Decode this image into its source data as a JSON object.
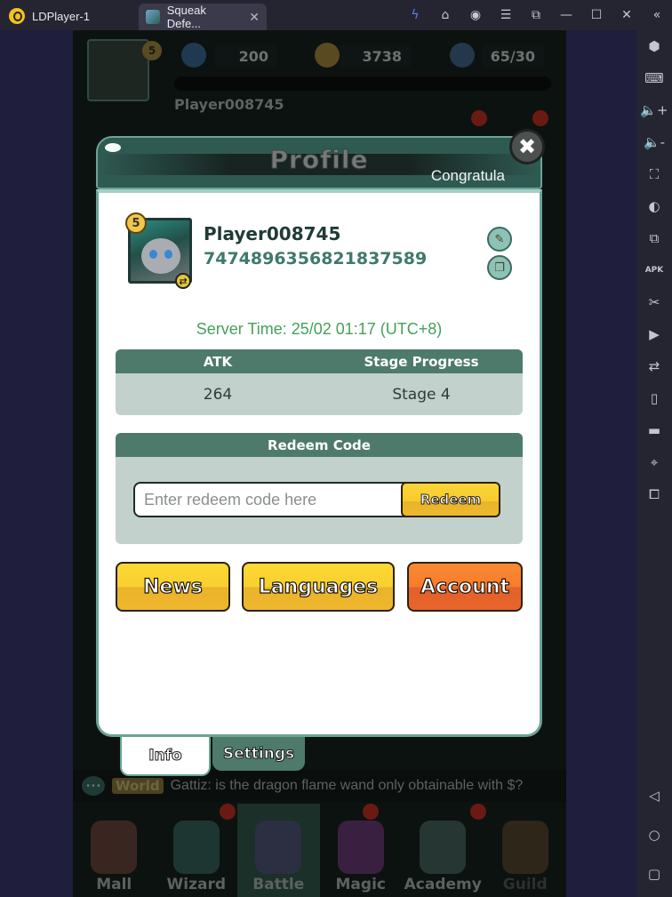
{
  "window": {
    "app_name": "LDPlayer-1",
    "active_tab": "Squeak Defe...",
    "toolbar_icons": [
      "bolt-icon",
      "store-icon",
      "account-icon",
      "menu-icon",
      "resize-icon",
      "minimize-icon",
      "maximize-icon",
      "close-icon",
      "collapse-icon"
    ]
  },
  "sidebar": {
    "icons": [
      "settings-icon",
      "keyboard-icon",
      "volume-up-icon",
      "volume-down-icon",
      "fullscreen-icon",
      "macro-icon",
      "multi-instance-icon",
      "apk-install-icon",
      "scissors-icon",
      "record-icon",
      "sync-icon",
      "shake-icon",
      "folder-icon",
      "location-icon",
      "more-icon"
    ],
    "android_nav": [
      "back-icon",
      "home-icon",
      "recents-icon"
    ]
  },
  "game_header": {
    "level": "5",
    "gems": "200",
    "coins": "3738",
    "energy": "65/30",
    "player_name": "Player008745"
  },
  "modal": {
    "title": "Profile",
    "marquee": "Congratula",
    "close_label": "✖",
    "profile": {
      "level": "5",
      "name": "Player008745",
      "id": "7474896356821837589"
    },
    "server_time": "Server Time: 25/02 01:17 (UTC+8)",
    "stats": {
      "headers": [
        "ATK",
        "Stage Progress"
      ],
      "values": [
        "264",
        "Stage 4"
      ]
    },
    "redeem": {
      "title": "Redeem Code",
      "placeholder": "Enter redeem code here",
      "value": "",
      "button": "Redeem"
    },
    "buttons": {
      "news": "News",
      "languages": "Languages",
      "account": "Account"
    },
    "tabs": {
      "info": "Info",
      "settings": "Settings"
    }
  },
  "chat": {
    "channel": "World",
    "message": "Gattiz: is the dragon flame wand only obtainable with $?"
  },
  "bottom_nav": [
    "Mall",
    "Wizard",
    "Battle",
    "Magic",
    "Academy",
    "Guild"
  ],
  "colors": {
    "primary_green": "#4e7a6c",
    "server_time_green": "#45a05a",
    "button_yellow": "#f7cf2f",
    "button_orange": "#f67c2c"
  }
}
